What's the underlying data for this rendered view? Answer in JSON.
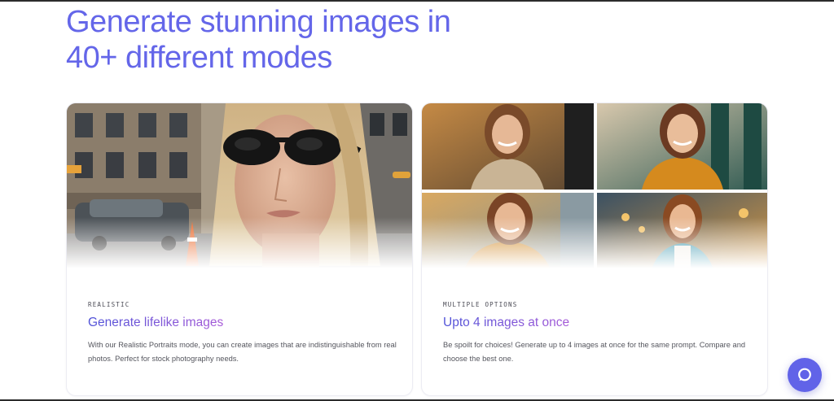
{
  "headline": {
    "line1": "Generate stunning images in",
    "line2": "40+ different modes"
  },
  "cards": [
    {
      "eyebrow": "REALISTIC",
      "title": "Generate lifelike images",
      "description": "With our Realistic Portraits mode, you can create images that are indistinguishable from real photos. Perfect for stock photography needs."
    },
    {
      "eyebrow": "MULTIPLE OPTIONS",
      "title": "Upto 4 images at once",
      "description": "Be spoilt for choices! Generate up to 4 images at once for the same prompt. Compare and choose the best one."
    }
  ],
  "chat": {
    "icon": "chat-bubble-icon"
  },
  "colors": {
    "accent": "#6466e9",
    "title_gradient_start": "#4f52d8",
    "title_gradient_end": "#a65ad8"
  }
}
